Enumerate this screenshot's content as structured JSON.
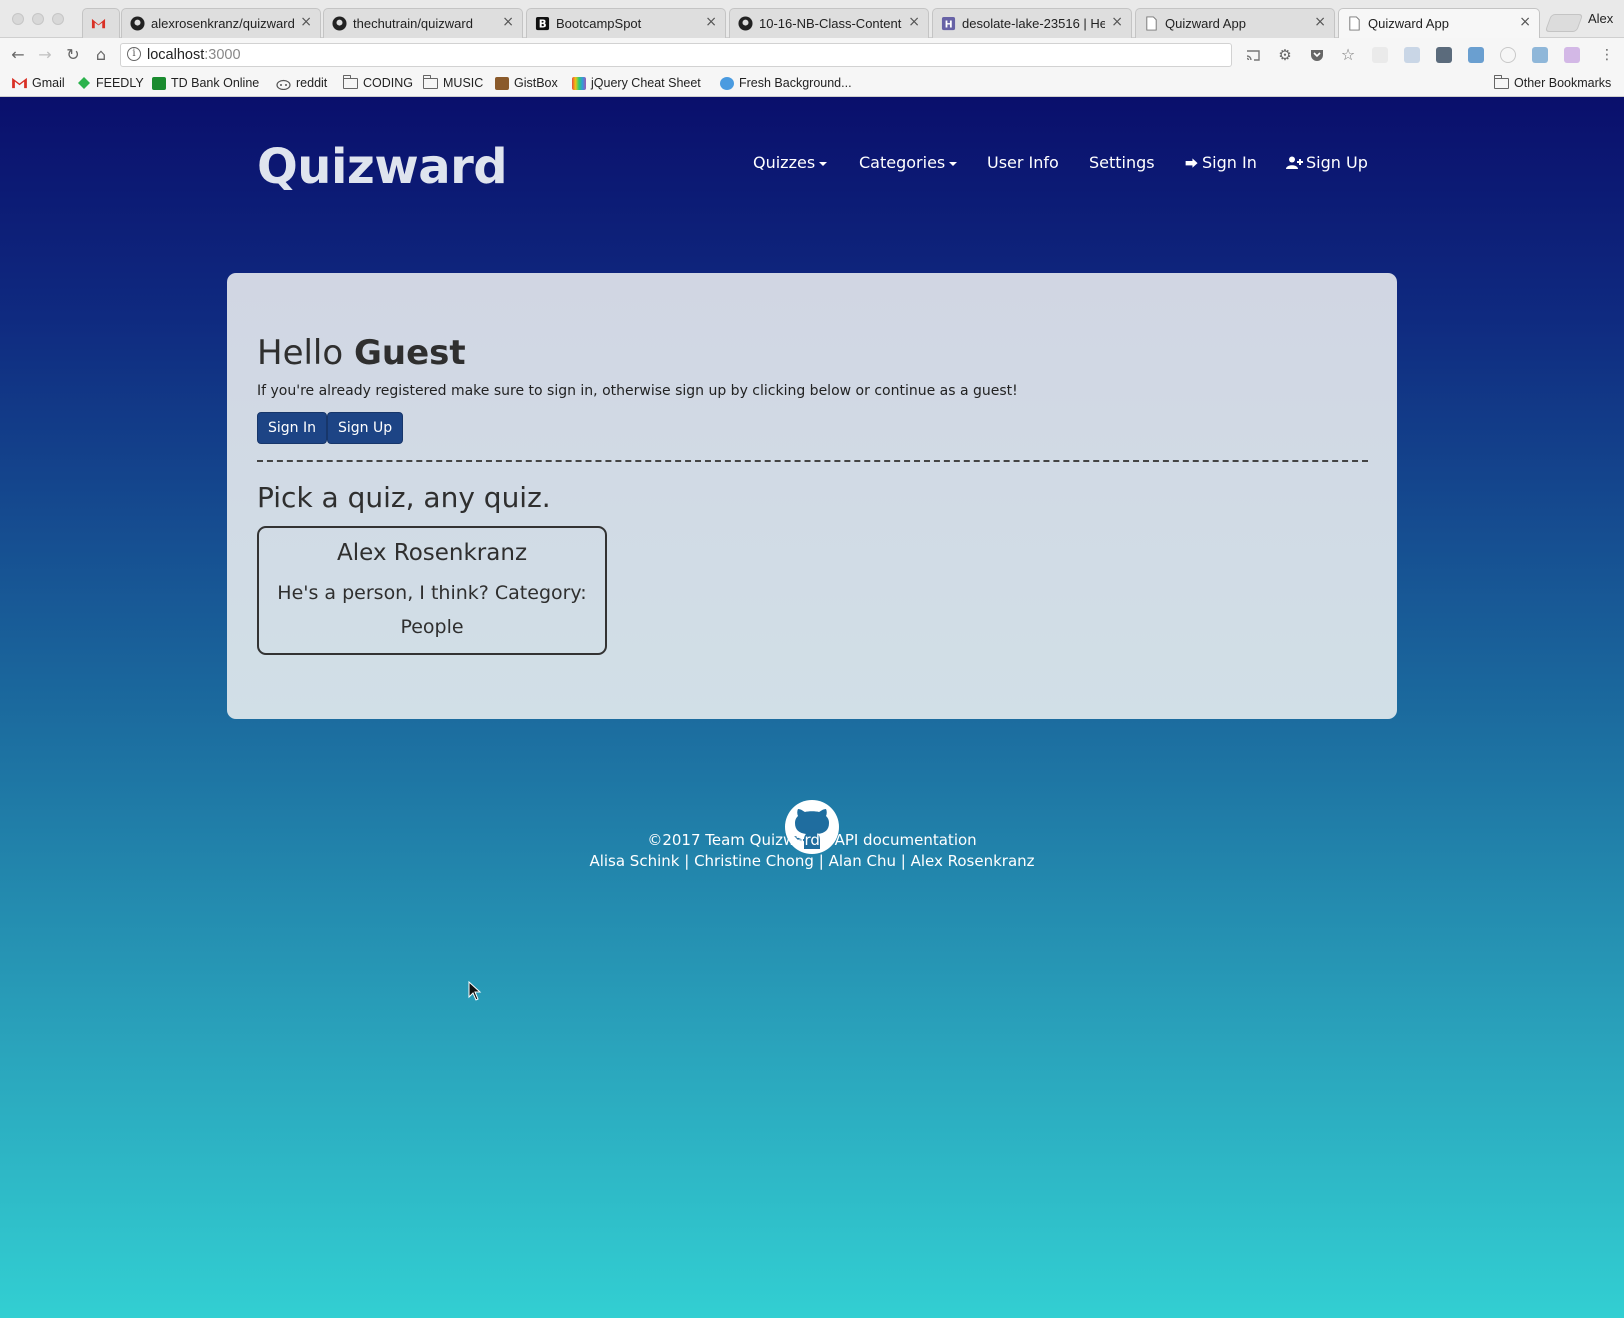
{
  "browser": {
    "tabs": [
      {
        "title": "",
        "icon": "gmail-icon"
      },
      {
        "title": "alexrosenkranz/quizward",
        "icon": "github-icon"
      },
      {
        "title": "thechutrain/quizward",
        "icon": "github-icon"
      },
      {
        "title": "BootcampSpot",
        "icon": "bootcampspot-icon"
      },
      {
        "title": "10-16-NB-Class-Content",
        "icon": "github-icon"
      },
      {
        "title": "desolate-lake-23516 | He",
        "icon": "heroku-icon"
      },
      {
        "title": "Quizward App",
        "icon": "page-icon"
      },
      {
        "title": "Quizward App",
        "icon": "page-icon",
        "active": true
      }
    ],
    "close_glyph": "×",
    "profile_name": "Alex",
    "url_host": "localhost",
    "url_port": ":3000",
    "bookmarks": [
      {
        "label": "Gmail",
        "icon": "gmail-icon"
      },
      {
        "label": "FEEDLY",
        "icon": "feedly-icon"
      },
      {
        "label": "TD Bank Online",
        "icon": "tdbank-icon"
      },
      {
        "label": "reddit",
        "icon": "reddit-icon"
      },
      {
        "label": "CODING",
        "icon": "folder-icon"
      },
      {
        "label": "MUSIC",
        "icon": "folder-icon"
      },
      {
        "label": "GistBox",
        "icon": "gistbox-icon"
      },
      {
        "label": "jQuery Cheat Sheet",
        "icon": "jquery-icon"
      },
      {
        "label": "Fresh Background...",
        "icon": "globe-icon"
      }
    ],
    "other_bookmarks": "Other Bookmarks"
  },
  "site": {
    "brand": "Quizward",
    "nav": {
      "quizzes": "Quizzes",
      "categories": "Categories",
      "user_info": "User Info",
      "settings": "Settings",
      "sign_in": "Sign In",
      "sign_up": "Sign Up"
    }
  },
  "main": {
    "greeting": "Hello",
    "user_name": "Guest",
    "intro": "If you're already registered make sure to sign in, otherwise sign up by clicking below or continue as a guest!",
    "sign_in_button": "Sign In",
    "sign_up_button": "Sign Up",
    "pick_heading": "Pick a quiz, any quiz.",
    "quizzes": [
      {
        "title": "Alex Rosenkranz",
        "description": "He's a person, I think? Category: People"
      }
    ]
  },
  "footer": {
    "copyright": "©2017 Team Quizward",
    "separator": "|",
    "api_link": "API documentation",
    "authors": [
      "Alisa Schink",
      "Christine Chong",
      "Alan Chu",
      "Alex Rosenkranz"
    ]
  },
  "colors": {
    "gradient_top": "#0a0f6c",
    "gradient_bottom": "#32cfd2",
    "button": "#1d4485",
    "panel": "#d1d6e3"
  }
}
